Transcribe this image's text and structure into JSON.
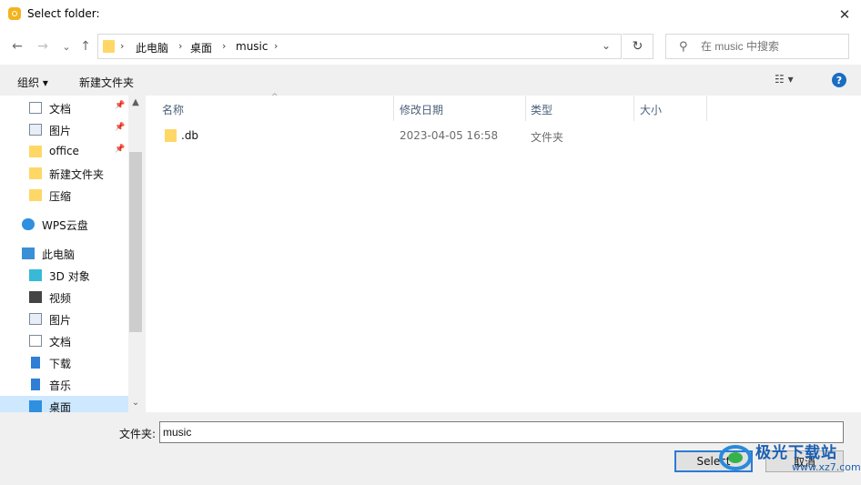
{
  "window": {
    "title": "Select folder:",
    "close_glyph": "✕"
  },
  "nav": {
    "back": "←",
    "forward": "→",
    "recent": "⌄",
    "up": "↑"
  },
  "address": {
    "crumbs": [
      "此电脑",
      "桌面",
      "music"
    ],
    "separator": "›",
    "dropdown": "⌄",
    "refresh": "↻"
  },
  "search": {
    "placeholder": "在 music 中搜索"
  },
  "toolbar": {
    "organize": "组织 ▾",
    "new_folder": "新建文件夹",
    "view_glyph": "☷ ▾",
    "help": "?"
  },
  "sidebar": {
    "items": [
      {
        "label": "文档",
        "icon": "document-icon",
        "pinned": true
      },
      {
        "label": "图片",
        "icon": "pictures-icon",
        "pinned": true
      },
      {
        "label": "office",
        "icon": "folder-icon",
        "pinned": true
      },
      {
        "label": "新建文件夹",
        "icon": "folder-icon"
      },
      {
        "label": "压缩",
        "icon": "folder-icon"
      },
      {
        "label": "WPS云盘",
        "icon": "cloud-icon"
      },
      {
        "label": "此电脑",
        "icon": "computer-icon"
      },
      {
        "label": "3D 对象",
        "icon": "3d-objects-icon"
      },
      {
        "label": "视频",
        "icon": "video-icon"
      },
      {
        "label": "图片",
        "icon": "pictures-icon"
      },
      {
        "label": "文档",
        "icon": "document-icon"
      },
      {
        "label": "下载",
        "icon": "download-icon"
      },
      {
        "label": "音乐",
        "icon": "music-icon"
      },
      {
        "label": "桌面",
        "icon": "desktop-icon",
        "selected": true
      }
    ],
    "pin_glyph": "📌",
    "scroll_up": "▲",
    "scroll_down": "⌄"
  },
  "columns": {
    "name": "名称",
    "date": "修改日期",
    "type": "类型",
    "size": "大小",
    "sort_glyph": "^"
  },
  "files": [
    {
      "name": ".db",
      "date": "2023-04-05 16:58",
      "type": "文件夹",
      "size": ""
    }
  ],
  "footer": {
    "folder_label": "文件夹:",
    "folder_value": "music",
    "select": "Select",
    "cancel": "取消"
  },
  "watermark": {
    "text": "极光下载站",
    "url": "www.xz7.com"
  },
  "colors": {
    "accent": "#2b7bd4",
    "selected": "#cde8ff",
    "folder": "#ffd766"
  }
}
